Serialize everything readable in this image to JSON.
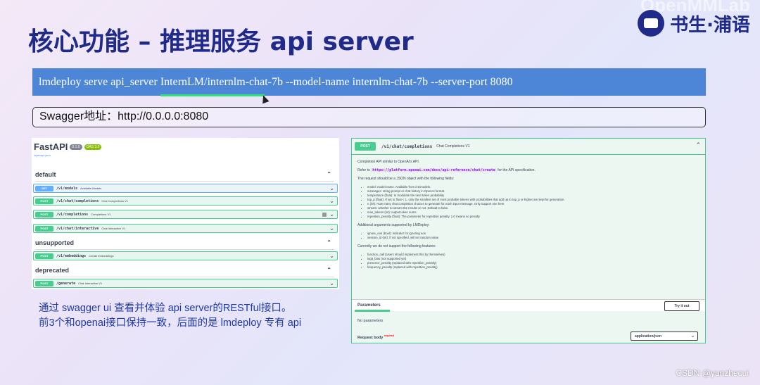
{
  "slide": {
    "title": "核心功能 – 推理服务 api server",
    "logo_watermark": "OpenMMLab",
    "logo_text": "书生·浦语",
    "command": "lmdeploy serve api_server InternLM/internlm-chat-7b --model-name internlm-chat-7b --server-port 8080",
    "swagger_label": "Swagger地址：http://0.0.0.0:8080",
    "caption_line1": "通过 swagger ui 查看并体验 api server的RESTful接口。",
    "caption_line2": "前3个和openai接口保持一致，后面的是 lmdeploy 专有 api",
    "credit": "CSDN @yunzhecui"
  },
  "fastapi": {
    "title": "FastAPI",
    "version_badge": "0.1.0",
    "oas_badge": "OAS 3.0",
    "link": "/openapi.json",
    "sections": [
      {
        "name": "default",
        "ops": [
          {
            "method": "GET",
            "path": "/v1/models",
            "summary": "Available Models"
          },
          {
            "method": "POST",
            "path": "/v1/chat/completions",
            "summary": "Chat Completions V1"
          },
          {
            "method": "POST",
            "path": "/v1/completions",
            "summary": "Completions V1"
          },
          {
            "method": "POST",
            "path": "/v1/chat/interactive",
            "summary": "Chat Interactive V1"
          }
        ]
      },
      {
        "name": "unsupported",
        "ops": [
          {
            "method": "POST",
            "path": "/v1/embeddings",
            "summary": "Create Embeddings"
          }
        ]
      },
      {
        "name": "deprecated",
        "ops": [
          {
            "method": "POST",
            "path": "/generate",
            "summary": "Chat Interactive V1"
          }
        ]
      }
    ]
  },
  "endpoint": {
    "method": "POST",
    "path": "/v1/chat/completions",
    "summary": "Chat Completions V1",
    "desc1": "Completion API similar to OpenAI's API.",
    "refer_prefix": "Refer to",
    "refer_url": "https://platform.openai.com/docs/api-reference/chat/create",
    "refer_suffix": "for the API specification.",
    "fields_intro": "The request should be a JSON object with the following fields:",
    "fields": [
      "model: model name. Available from /v1/models.",
      "messages: string prompt or chat history in OpenAI format.",
      "temperature (float): to modulate the next token probability",
      "top_p (float): If set to float < 1, only the smallest set of most probable tokens with probabilities that add up to top_p or higher are kept for generation.",
      "n (int): How many chat completion choices to generate for each input message. Only support one here.",
      "stream: whether to stream the results or not. Default to false.",
      "max_tokens (int): output token nums",
      "repetition_penalty (float): The parameter for repetition penalty. 1.0 means no penalty"
    ],
    "additional_intro": "Additional arguments supported by LMDeploy:",
    "additional": [
      "ignore_eos (bool): indicator for ignoring eos",
      "session_id (int): if not specified, will set random value"
    ],
    "unsupported_intro": "Currently we do not support the following features:",
    "unsupported": [
      "function_call (Users should implement this by themselves)",
      "logit_bias (not supported yet)",
      "presence_penalty (replaced with repetition_penalty)",
      "frequency_penalty (replaced with repetition_penalty)"
    ],
    "params_label": "Parameters",
    "try_label": "Try it out",
    "no_params": "No parameters",
    "request_body_label": "Request body",
    "required_label": "required",
    "content_type": "application/json"
  }
}
